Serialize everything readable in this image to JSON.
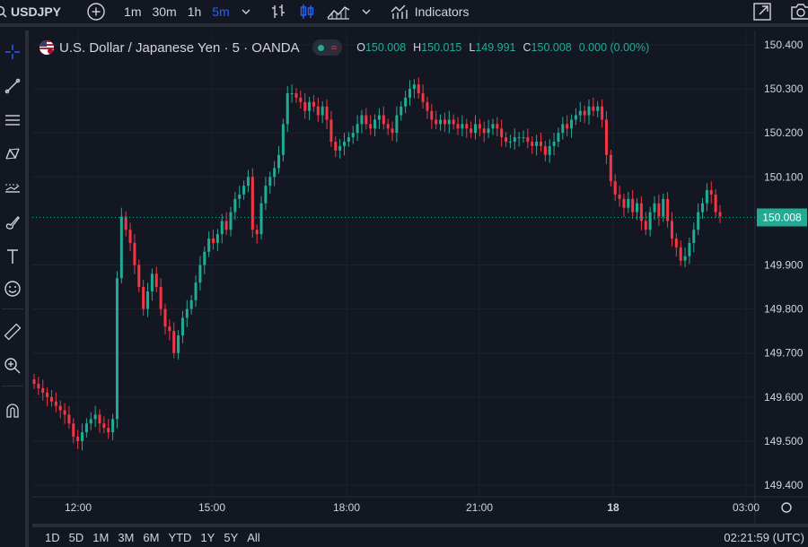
{
  "toolbar": {
    "symbol": "USDJPY",
    "intervals": [
      "1m",
      "30m",
      "1h",
      "5m"
    ],
    "active_interval": "5m",
    "indicators_label": "Indicators"
  },
  "legend": {
    "title": "U.S. Dollar / Japanese Yen · 5 · OANDA",
    "ohlc": [
      {
        "key": "O",
        "value": "150.008"
      },
      {
        "key": "H",
        "value": "150.015"
      },
      {
        "key": "L",
        "value": "149.991"
      },
      {
        "key": "C",
        "value": "150.008"
      }
    ],
    "change": "0.000 (0.00%)"
  },
  "price_axis": {
    "labels": [
      "150.400",
      "150.300",
      "150.200",
      "150.100",
      "149.900",
      "149.800",
      "149.700",
      "149.600",
      "149.500",
      "149.400"
    ],
    "last_price": "150.008"
  },
  "time_axis": {
    "labels": [
      "12:00",
      "15:00",
      "18:00",
      "21:00",
      "18",
      "03:00"
    ]
  },
  "bottom": {
    "ranges": [
      "1D",
      "5D",
      "1M",
      "3M",
      "6M",
      "YTD",
      "1Y",
      "5Y",
      "All"
    ],
    "clock": "02:21:59 (UTC)"
  },
  "colors": {
    "background": "#131722",
    "up": "#22ab94",
    "down": "#f23645",
    "accent": "#2962ff",
    "grid": "#1e222d"
  },
  "chart_data": {
    "type": "candlestick",
    "ylim": [
      149.4,
      150.4
    ],
    "interval_minutes": 5,
    "last_price": 150.008,
    "close": [
      149.63,
      149.62,
      149.61,
      149.6,
      149.59,
      149.58,
      149.57,
      149.56,
      149.54,
      149.51,
      149.5,
      149.52,
      149.54,
      149.55,
      149.56,
      149.54,
      149.53,
      149.52,
      149.55,
      149.87,
      150.01,
      149.98,
      149.95,
      149.9,
      149.85,
      149.8,
      149.84,
      149.88,
      149.85,
      149.8,
      149.76,
      149.75,
      149.7,
      149.74,
      149.78,
      149.8,
      149.82,
      149.86,
      149.9,
      149.93,
      149.96,
      149.95,
      149.97,
      150.0,
      149.98,
      150.02,
      150.05,
      150.06,
      150.08,
      150.1,
      149.98,
      149.97,
      150.04,
      150.08,
      150.1,
      150.12,
      150.15,
      150.22,
      150.29,
      150.29,
      150.28,
      150.27,
      150.25,
      150.27,
      150.26,
      150.24,
      150.26,
      150.23,
      150.18,
      150.16,
      150.17,
      150.18,
      150.19,
      150.2,
      150.22,
      150.24,
      150.22,
      150.21,
      150.23,
      150.24,
      150.22,
      150.21,
      150.2,
      150.24,
      150.26,
      150.28,
      150.3,
      150.31,
      150.29,
      150.27,
      150.25,
      150.23,
      150.22,
      150.23,
      150.22,
      150.23,
      150.22,
      150.21,
      150.22,
      150.21,
      150.2,
      150.22,
      150.21,
      150.2,
      150.21,
      150.22,
      150.21,
      150.19,
      150.18,
      150.18,
      150.19,
      150.19,
      150.19,
      150.18,
      150.17,
      150.18,
      150.17,
      150.15,
      150.17,
      150.18,
      150.2,
      150.22,
      150.21,
      150.23,
      150.24,
      150.25,
      150.24,
      150.26,
      150.25,
      150.26,
      150.23,
      150.15,
      150.09,
      150.06,
      150.05,
      150.03,
      150.05,
      150.02,
      150.04,
      150.0,
      149.98,
      150.02,
      150.04,
      150.01,
      150.05,
      150.0,
      149.96,
      149.94,
      149.91,
      149.92,
      149.95,
      149.98,
      150.02,
      150.04,
      150.07,
      150.06,
      150.02,
      150.01
    ]
  }
}
